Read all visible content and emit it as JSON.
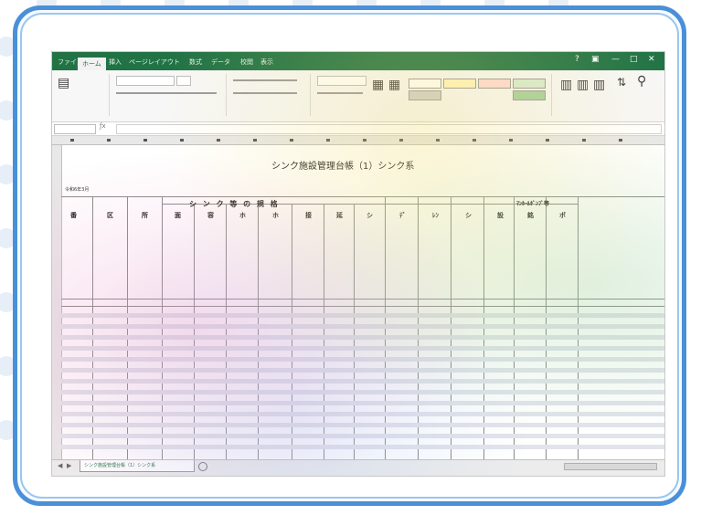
{
  "app": {
    "ribbon_tabs": [
      "ファイル",
      "ホーム",
      "挿入",
      "ページレイアウト",
      "数式",
      "データ",
      "校閲",
      "表示"
    ],
    "active_tab": "ホーム",
    "window_controls": [
      "?",
      "▣",
      "—",
      "□",
      "✕"
    ]
  },
  "sheet": {
    "title": "シンク施設管理台帳（1）シンク系",
    "date_label": "令和6年3月",
    "section_tank": "シ ン ク 等 の 規 格",
    "section_pump": "ﾏﾝﾎｰﾙﾎﾟﾝﾌﾟ等",
    "columns": [
      "番",
      "区",
      "所",
      "面",
      "容",
      "ホ",
      "ホ",
      "接",
      "延",
      "シ",
      "ﾃﾞ",
      "ﾚﾝ",
      "シ",
      "設",
      "銘",
      "ポ"
    ],
    "tab_name": "シンク施設管理台帳（1）シンク系"
  },
  "colors": {
    "excel_green": "#217346",
    "frame_blue": "#4a90d9",
    "frame_inner_blue": "#9cc6ee"
  }
}
